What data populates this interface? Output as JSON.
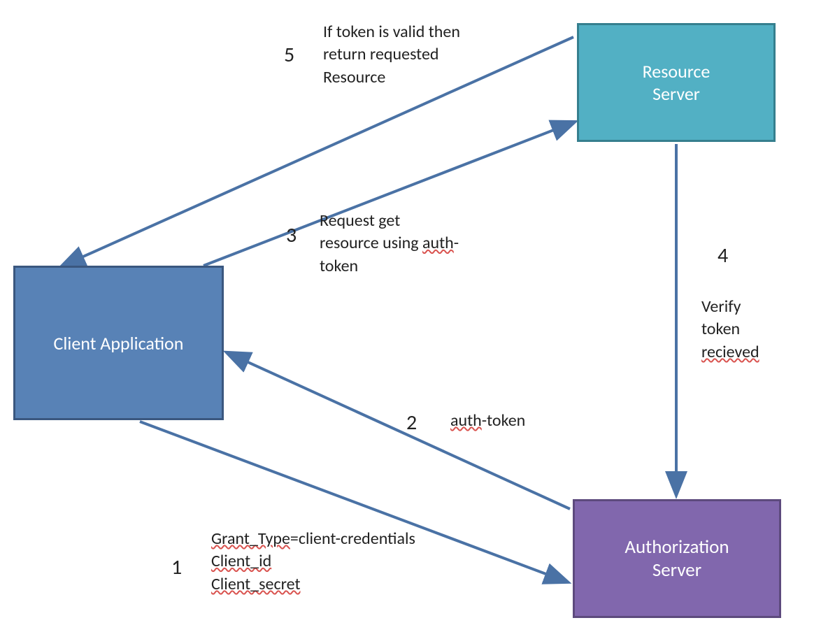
{
  "nodes": {
    "client": {
      "label": "Client Application",
      "fill": "#5882b6",
      "border": "#3a577f"
    },
    "resource": {
      "label": "Resource Server",
      "fill": "#52b0c4",
      "border": "#357f8e"
    },
    "auth": {
      "label": "Authorization Server",
      "fill": "#8167ad",
      "border": "#5d4a7d"
    }
  },
  "steps": {
    "s1": {
      "num": "1",
      "label_a": "Grant_Type",
      "label_b": "=client-credentials",
      "label_c": "Client_id",
      "label_d": "Client_secret"
    },
    "s2": {
      "num": "2",
      "label_a": "auth",
      "label_b": "-token"
    },
    "s3": {
      "num": "3",
      "label_a": "Request get",
      "label_b": "resource using ",
      "label_c": "auth",
      "label_d": "-",
      "label_e": "token"
    },
    "s4": {
      "num": "4",
      "label_a": "Verify",
      "label_b": "token",
      "label_c": "recieved"
    },
    "s5": {
      "num": "5",
      "label_a": "If token is valid then",
      "label_b": "return requested",
      "label_c": "Resource"
    }
  },
  "arrow_color": "#4a72a5"
}
